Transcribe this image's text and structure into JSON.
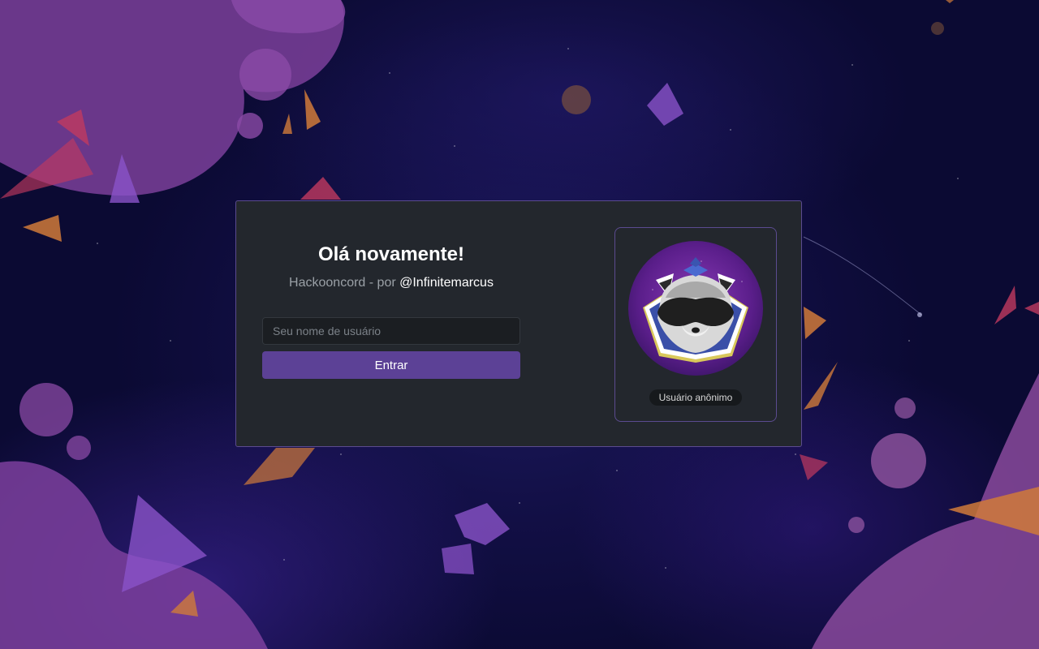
{
  "login": {
    "title": "Olá novamente!",
    "subtitle_prefix": "Hackooncord - por ",
    "author_handle": "@Infinitemarcus",
    "username_placeholder": "Seu nome de usuário",
    "username_value": "",
    "submit_label": "Entrar"
  },
  "profile": {
    "avatar_icon": "raccoon-avatar-icon",
    "username_badge": "Usuário anônimo"
  },
  "colors": {
    "accent": "#5c4196",
    "panel_bg": "#23272d",
    "panel_border": "#5b4b8f",
    "background": "#120f45"
  }
}
